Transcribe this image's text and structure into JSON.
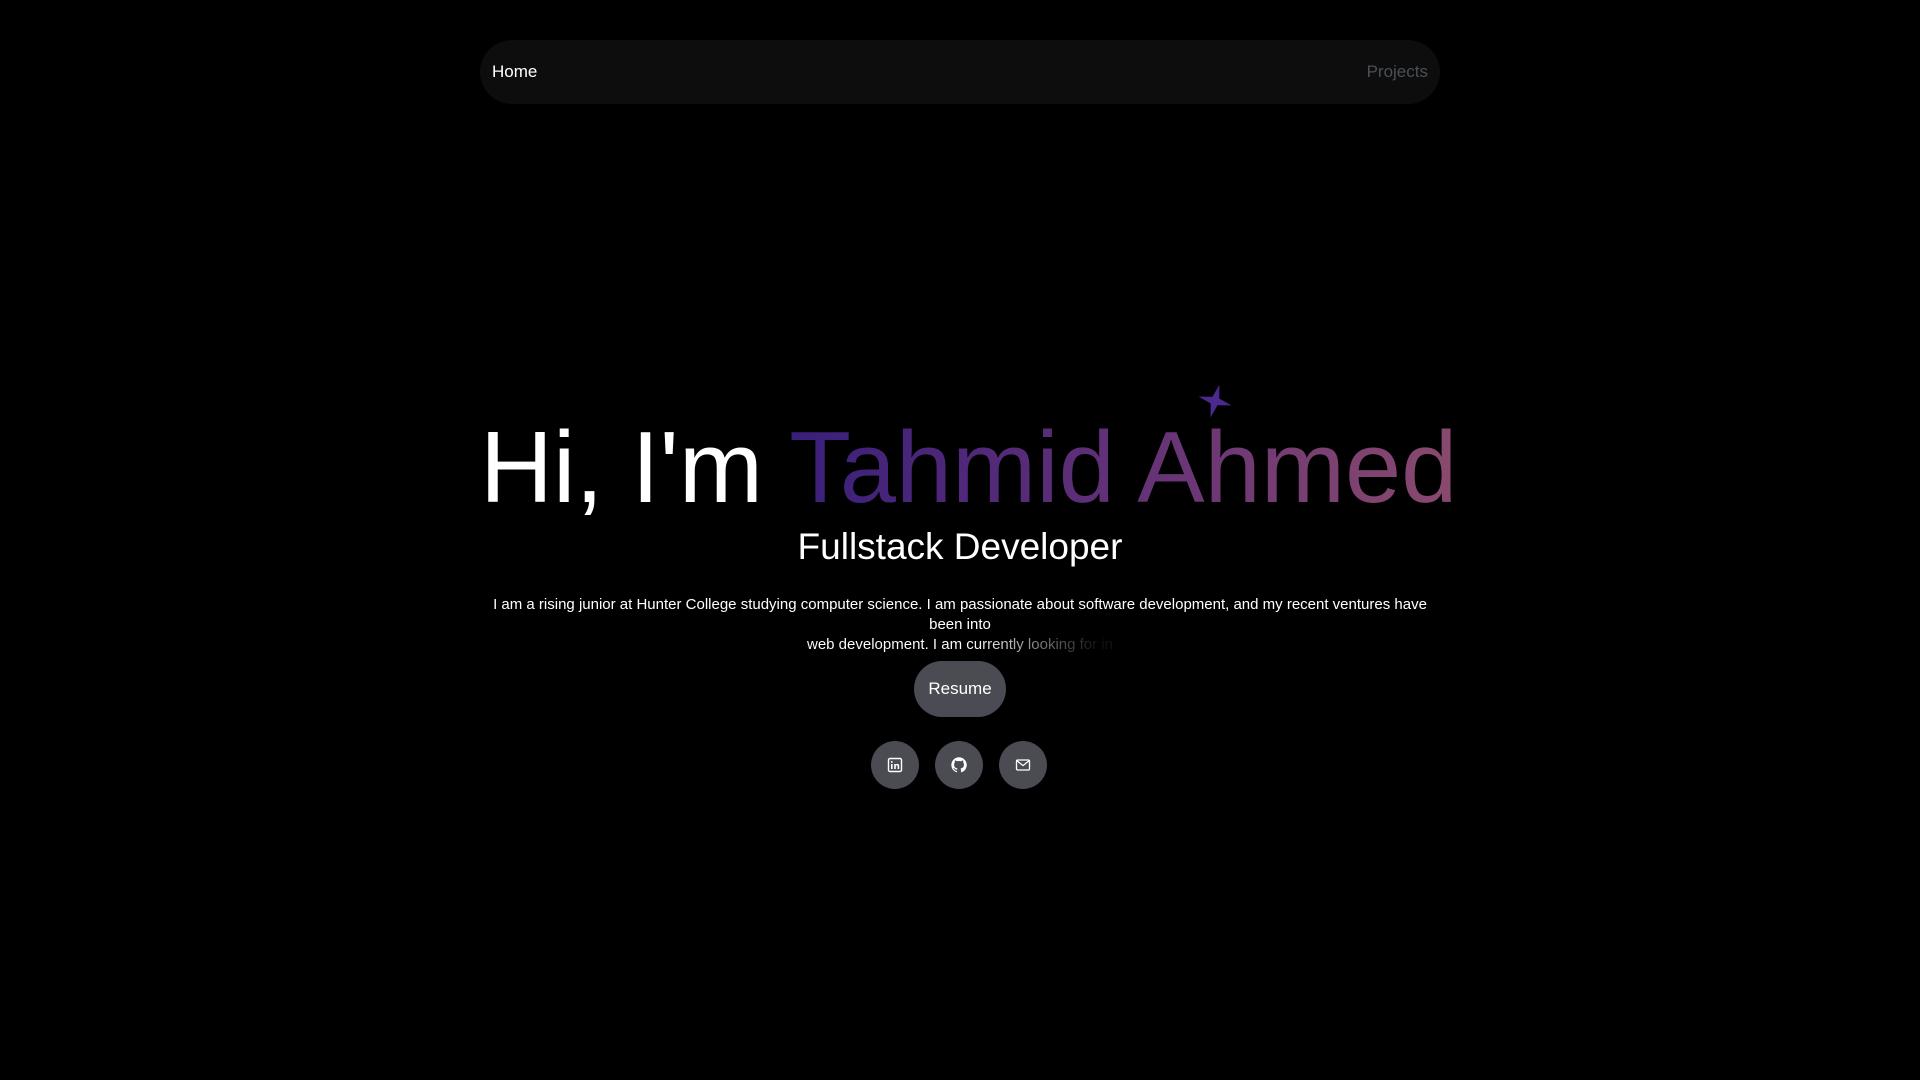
{
  "nav": {
    "home_label": "Home",
    "projects_label": "Projects"
  },
  "hero": {
    "greeting": "Hi, I'm ",
    "name": "Tahmid Ahmed",
    "subtitle": "Fullstack Developer",
    "bio_line1": "I am a rising junior at Hunter College studying computer science. I am passionate about software development, and my recent ventures have been into",
    "bio_line2": "web development. I am currently looking for in"
  },
  "actions": {
    "resume_label": "Resume"
  },
  "socials": [
    {
      "icon": "linkedin-icon"
    },
    {
      "icon": "github-icon"
    },
    {
      "icon": "mail-icon"
    }
  ],
  "colors": {
    "background": "#000000",
    "navbar": "#0d0d0d",
    "name_gradient_start": "#3a1f7a",
    "name_gradient_end": "#8a4a6e",
    "button": "#4b4b53",
    "sparkle": "#4a2a8c"
  }
}
